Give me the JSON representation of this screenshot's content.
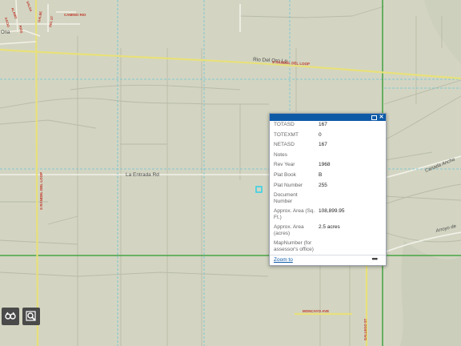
{
  "map": {
    "roads": {
      "rio_del_oro": "Rio Del Oro Lp",
      "rio_del_oro_shield": "S RANDEL DEL LOOP",
      "la_entrada": "La Entrada Rd",
      "canada_ancha": "Canada Ancha",
      "arroyo": "Arroyo de",
      "vertical_left": "S RANDEL DEL LOOP",
      "gallego": "GALLEGO ST",
      "camino_rio": "CAMINO RIO",
      "moncayo": "MONCAYO AVE",
      "ona": "Ona"
    },
    "small_labels": [
      "ALAMO",
      "SALSA",
      "SACIO",
      "GALBE",
      "DEL ST",
      "RIOS"
    ]
  },
  "popup": {
    "fields": [
      {
        "name": "TOTASD",
        "value": "167"
      },
      {
        "name": "TOTEXMT",
        "value": "0"
      },
      {
        "name": "NETASD",
        "value": "167"
      },
      {
        "name": "Notes",
        "value": ""
      },
      {
        "name": "Rev Year",
        "value": "1968"
      },
      {
        "name": "Plat Book",
        "value": "B"
      },
      {
        "name": "Plat Number",
        "value": "255"
      },
      {
        "name": "Document Number",
        "value": ""
      },
      {
        "name": "Approx. Area (Sq. Ft.)",
        "value": "108,899.95"
      },
      {
        "name": "Approx. Area (acres)",
        "value": "2.5 acres"
      },
      {
        "name": "MapNumber (for assessor's office)",
        "value": ""
      }
    ],
    "zoom_to": "Zoom to",
    "more_actions": "•••",
    "close_glyph": "✕"
  },
  "colors": {
    "popup_header": "#0e5aa7",
    "map_background": "#d3d5c2",
    "road_yellow": "#e8e07a",
    "grid_cyan": "#6bc4d6",
    "grid_green": "#2c9a2c"
  },
  "toolbar": {
    "basemap_icon": "basemap-gallery-icon",
    "search_icon": "zoom-search-icon"
  }
}
